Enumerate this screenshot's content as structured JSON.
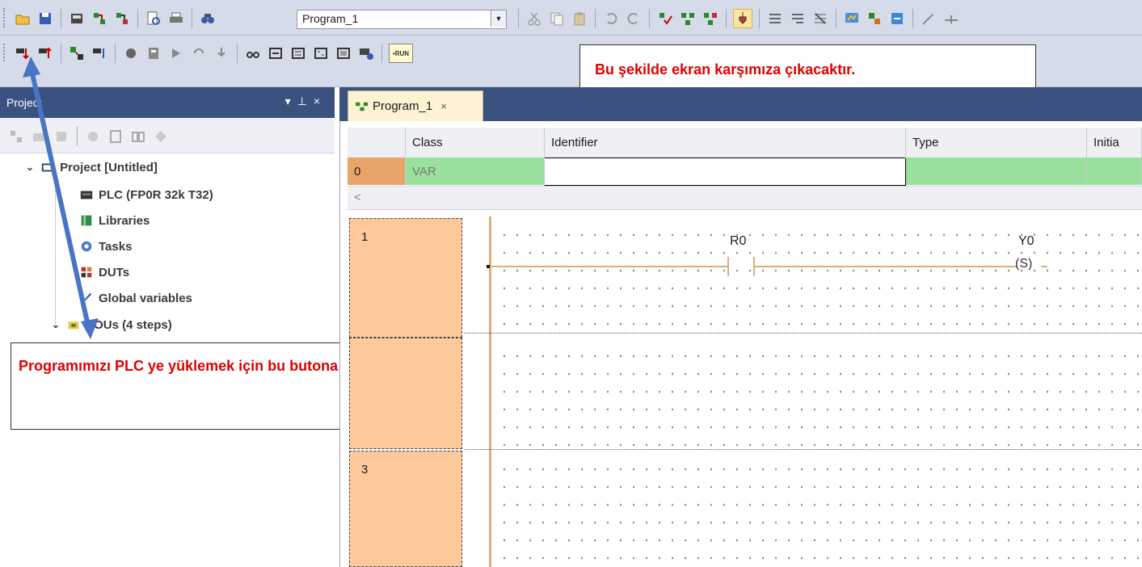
{
  "toolbar": {
    "program_select": "Program_1"
  },
  "notes": {
    "top": "Bu şekilde ekran karşımıza çıkacaktır.",
    "left": "Programımızı PLC ye yüklemek için bu butona basalım."
  },
  "project_panel": {
    "title": "Project",
    "tree": [
      {
        "label": "Project [Untitled]",
        "icon": "project-icon"
      },
      {
        "label": "PLC (FP0R 32k T32)",
        "icon": "plc-icon"
      },
      {
        "label": "Libraries",
        "icon": "library-icon"
      },
      {
        "label": "Tasks",
        "icon": "gear-icon"
      },
      {
        "label": "DUTs",
        "icon": "dut-icon"
      },
      {
        "label": "Global variables",
        "icon": "variables-icon"
      },
      {
        "label": "POUs (4 steps)",
        "icon": "pou-icon"
      }
    ]
  },
  "editor": {
    "tab_label": "Program_1",
    "columns": [
      "Class",
      "Identifier",
      "Type",
      "Initia"
    ],
    "var_row": {
      "index": "0",
      "class": "VAR"
    },
    "rungs": [
      "1",
      "3"
    ],
    "contact_label": "R0",
    "coil_label": "Y0",
    "coil_symbol": "(S)",
    "run_label": "•RUN"
  },
  "colors": {
    "panel_header": "#3b5281",
    "var_row": "#99e19d",
    "rung_number": "#fdc99c",
    "note_text": "#e00000",
    "arrow": "#4a74c4"
  }
}
